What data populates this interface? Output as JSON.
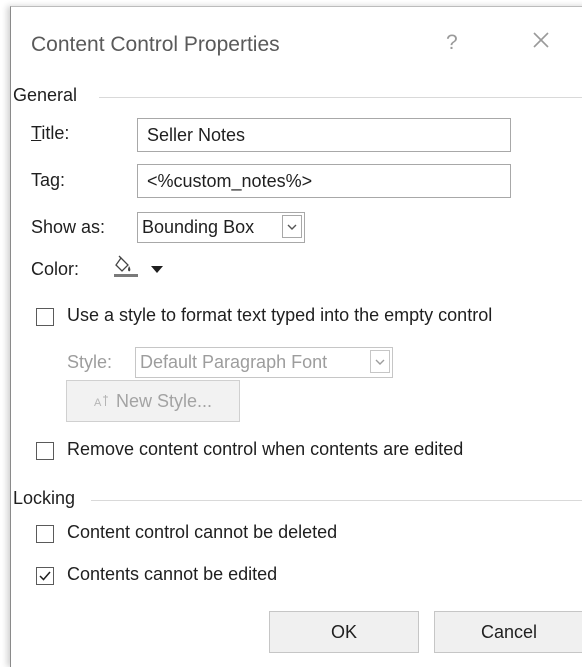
{
  "dialog": {
    "title": "Content Control Properties",
    "help_symbol": "?"
  },
  "general": {
    "section_label": "General",
    "title_label": "Title:",
    "title_value": "Seller Notes",
    "tag_label": "Tag:",
    "tag_value": "<%custom_notes%>",
    "show_as_label": "Show as:",
    "show_as_value": "Bounding Box",
    "color_label": "Color:",
    "use_style_label": "Use a style to format text typed into the empty control",
    "use_style_checked": false,
    "style_label": "Style:",
    "style_value": "Default Paragraph Font",
    "new_style_label": "New Style...",
    "remove_cc_label": "Remove content control when contents are edited",
    "remove_cc_checked": false
  },
  "locking": {
    "section_label": "Locking",
    "cannot_delete_label": "Content control cannot be deleted",
    "cannot_delete_checked": false,
    "cannot_edit_label": "Contents cannot be edited",
    "cannot_edit_checked": true
  },
  "buttons": {
    "ok_label": "OK",
    "cancel_label": "Cancel"
  },
  "colors": {
    "paint_bucket_underline": "#7a7a7a"
  }
}
